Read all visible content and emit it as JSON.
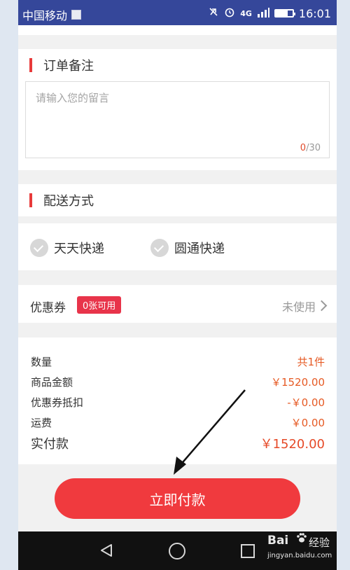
{
  "status_bar": {
    "carrier": "中国移动",
    "network": "4G",
    "time": "16:01",
    "battery_level": 0.7
  },
  "order_note": {
    "title": "订单备注",
    "placeholder": "请输入您的留言",
    "count_current": "0",
    "count_max": "/30"
  },
  "delivery": {
    "title": "配送方式",
    "options": [
      "天天快递",
      "圆通快递"
    ]
  },
  "coupon": {
    "label": "优惠券",
    "badge": "0张可用",
    "status": "未使用"
  },
  "summary": {
    "rows": [
      {
        "label": "数量",
        "value": "共1件"
      },
      {
        "label": "商品金额",
        "value": "￥1520.00"
      },
      {
        "label": "优惠券抵扣",
        "value": "-￥0.00"
      },
      {
        "label": "运费",
        "value": "￥0.00"
      }
    ],
    "total_label": "实付款",
    "total_value": "￥1520.00"
  },
  "pay_button": "立即付款",
  "watermark": {
    "brand": "Bai",
    "suffix": "经验",
    "url": "jingyan.baidu.com"
  },
  "colors": {
    "accent": "#f03a3e",
    "price": "#e65a24",
    "status_bar": "#35479a"
  }
}
